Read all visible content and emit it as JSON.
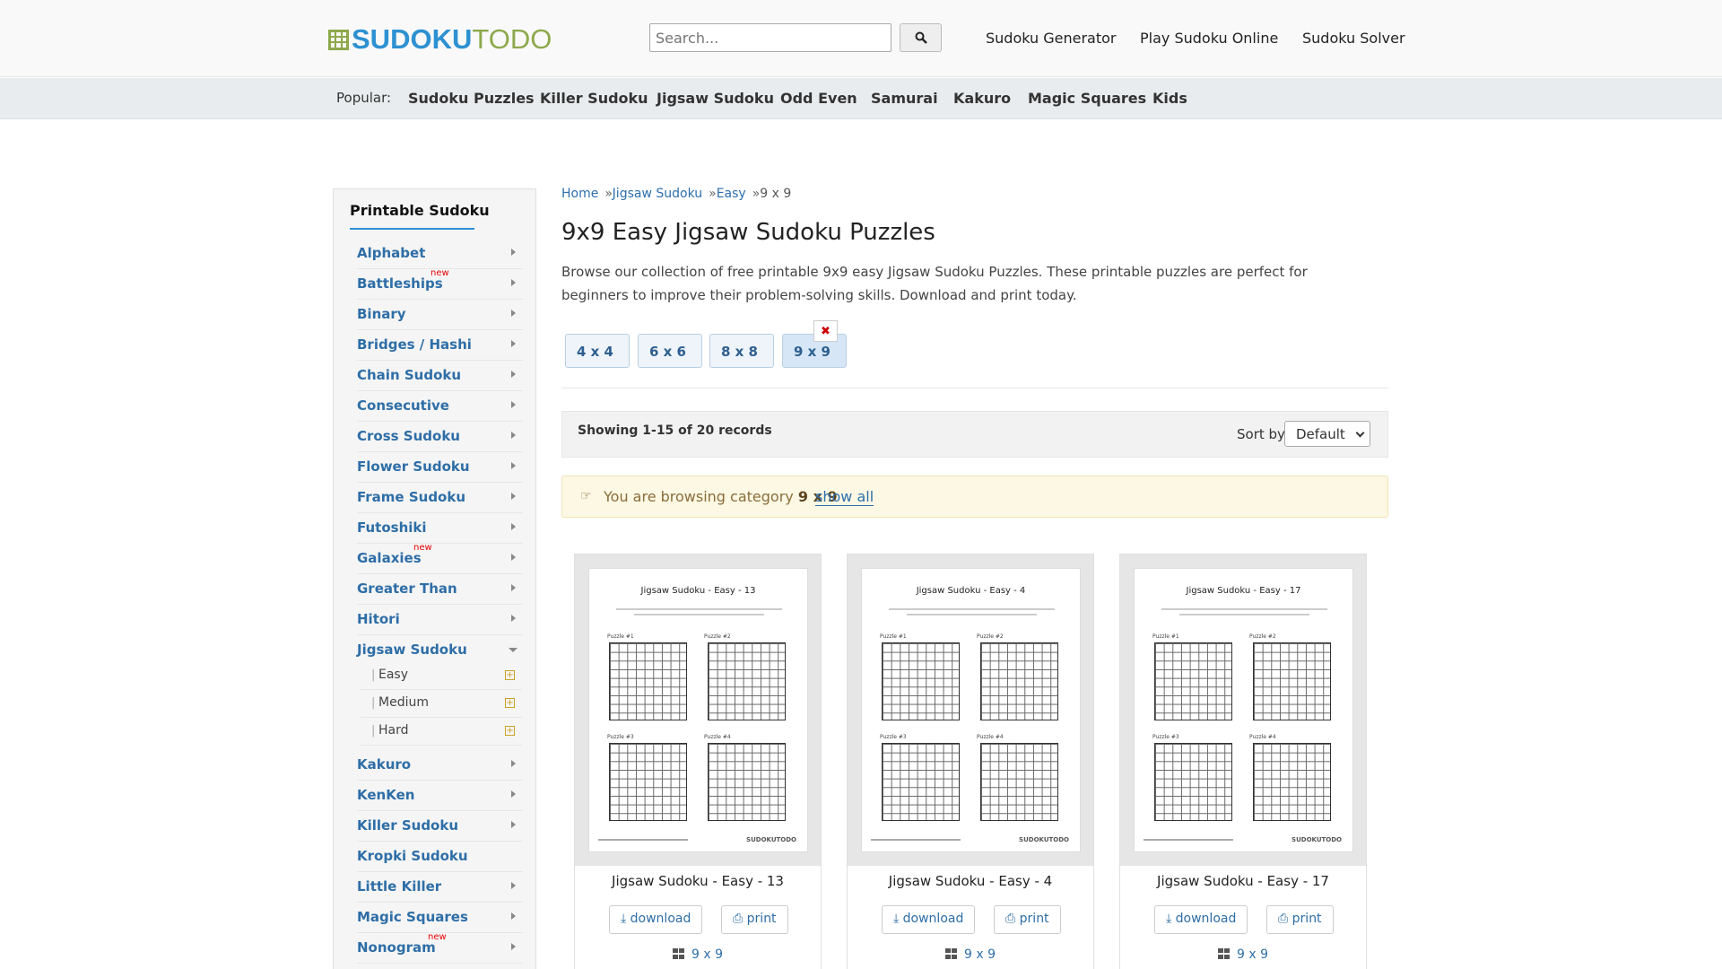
{
  "header": {
    "logo_part1": "SUDOKU",
    "logo_part2": "TODO",
    "search_placeholder": "Search...",
    "nav": [
      "Sudoku Generator",
      "Play Sudoku Online",
      "Sudoku Solver"
    ]
  },
  "popular": {
    "label": "Popular:",
    "items": [
      "Sudoku Puzzles",
      "Killer Sudoku",
      "Jigsaw Sudoku",
      "Odd Even",
      "Samurai",
      "Kakuro",
      "Magic Squares",
      "Kids"
    ]
  },
  "sidebar": {
    "title": "Printable Sudoku",
    "new_label": "new",
    "items": [
      {
        "label": "Alphabet"
      },
      {
        "label": "Battleships",
        "new": true
      },
      {
        "label": "Binary"
      },
      {
        "label": "Bridges / Hashi"
      },
      {
        "label": "Chain Sudoku"
      },
      {
        "label": "Consecutive"
      },
      {
        "label": "Cross Sudoku"
      },
      {
        "label": "Flower Sudoku"
      },
      {
        "label": "Frame Sudoku"
      },
      {
        "label": "Futoshiki"
      },
      {
        "label": "Galaxies",
        "new": true
      },
      {
        "label": "Greater Than"
      },
      {
        "label": "Hitori"
      },
      {
        "label": "Jigsaw Sudoku",
        "expanded": true
      },
      {
        "label": "Kakuro"
      },
      {
        "label": "KenKen"
      },
      {
        "label": "Killer Sudoku"
      },
      {
        "label": "Kropki Sudoku"
      },
      {
        "label": "Little Killer"
      },
      {
        "label": "Magic Squares"
      },
      {
        "label": "Nonogram",
        "new": true
      }
    ],
    "subitems": [
      "Easy",
      "Medium",
      "Hard"
    ]
  },
  "breadcrumb": [
    "Home",
    "Jigsaw Sudoku",
    "Easy",
    "9 x 9"
  ],
  "breadcrumb_sep": "»",
  "page": {
    "title": "9x9 Easy Jigsaw Sudoku Puzzles",
    "description": "Browse our collection of free printable 9x9 easy Jigsaw Sudoku Puzzles. These printable puzzles are perfect for beginners to improve their problem-solving skills. Download and print today."
  },
  "sizes": [
    {
      "label": "4 x 4",
      "active": false
    },
    {
      "label": "6 x 6",
      "active": false
    },
    {
      "label": "8 x 8",
      "active": false
    },
    {
      "label": "9 x 9",
      "active": true
    }
  ],
  "records": {
    "text": "Showing 1-15 of 20 records",
    "sort_label": "Sort by:",
    "sort_value": "Default"
  },
  "notice": {
    "prefix": "You are browsing category",
    "category": "9 x 9",
    "show_all": "show all"
  },
  "cards": [
    {
      "title": "Jigsaw Sudoku - Easy - 13",
      "download": "download",
      "print": "print",
      "size": "9 x 9"
    },
    {
      "title": "Jigsaw Sudoku - Easy - 4",
      "download": "download",
      "print": "print",
      "size": "9 x 9"
    },
    {
      "title": "Jigsaw Sudoku - Easy - 17",
      "download": "download",
      "print": "print",
      "size": "9 x 9"
    }
  ],
  "thumb": {
    "puzzle_labels": [
      "Puzzle #1",
      "Puzzle #2",
      "Puzzle #3",
      "Puzzle #4"
    ],
    "brand": "SUDOKUTODO"
  }
}
